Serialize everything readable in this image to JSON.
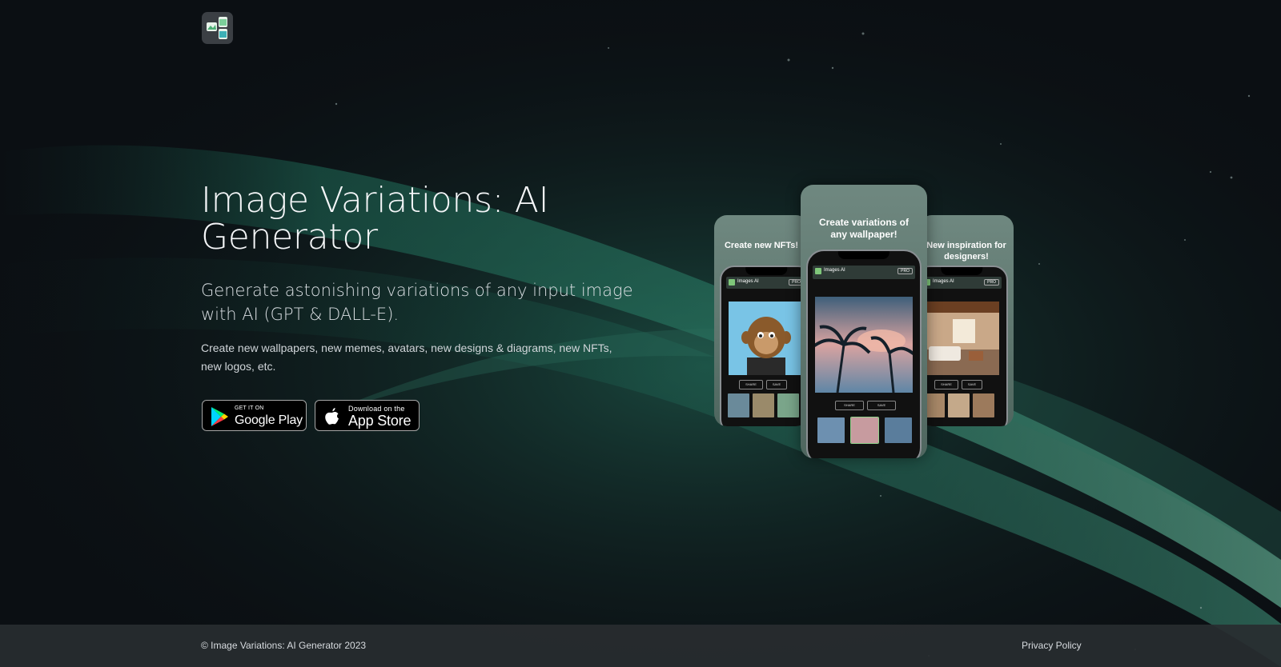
{
  "app_logo": {
    "icon": "image-variations-logo-icon"
  },
  "hero": {
    "title": "Image Variations: AI Generator",
    "subtitle": "Generate astonishing variations of any input image with AI (GPT & DALL-E).",
    "description": "Create new wallpapers, new memes, avatars, new designs & diagrams, new NFTs, new logos, etc."
  },
  "stores": {
    "google_play": {
      "small": "GET IT ON",
      "big": "Google Play",
      "icon": "google-play-icon"
    },
    "app_store": {
      "small": "Download on the",
      "big": "App Store",
      "icon": "apple-icon"
    }
  },
  "screenshots": {
    "left_caption": "Create new NFTs!",
    "center_caption": "Create variations of any wallpaper!",
    "right_caption": "New inspiration for designers!",
    "app_name": "Images AI",
    "pro_label": "PRO",
    "share_label": "SHARE",
    "save_label": "SAVE"
  },
  "colors": {
    "background": "#0c1014",
    "aurora": "#2e7d66",
    "panel": "#6f8880",
    "footer": "#2a2e32"
  },
  "footer": {
    "copyright": "© Image Variations: AI Generator 2023",
    "privacy": "Privacy Policy"
  }
}
